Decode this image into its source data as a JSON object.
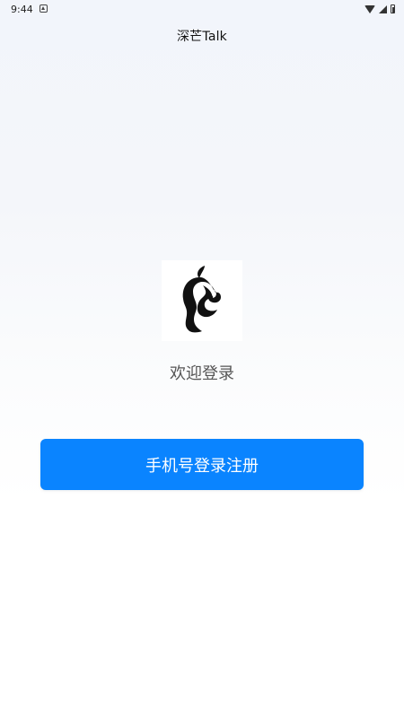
{
  "status_bar": {
    "time": "9:44",
    "icons": [
      "notification-icon",
      "wifi-icon",
      "signal-icon",
      "battery-icon"
    ]
  },
  "app_bar": {
    "title": "深芒Talk"
  },
  "logo": {
    "icon": "mango-logo"
  },
  "welcome_text": "欢迎登录",
  "login_button": {
    "label": "手机号登录注册",
    "color": "#0a84ff"
  }
}
